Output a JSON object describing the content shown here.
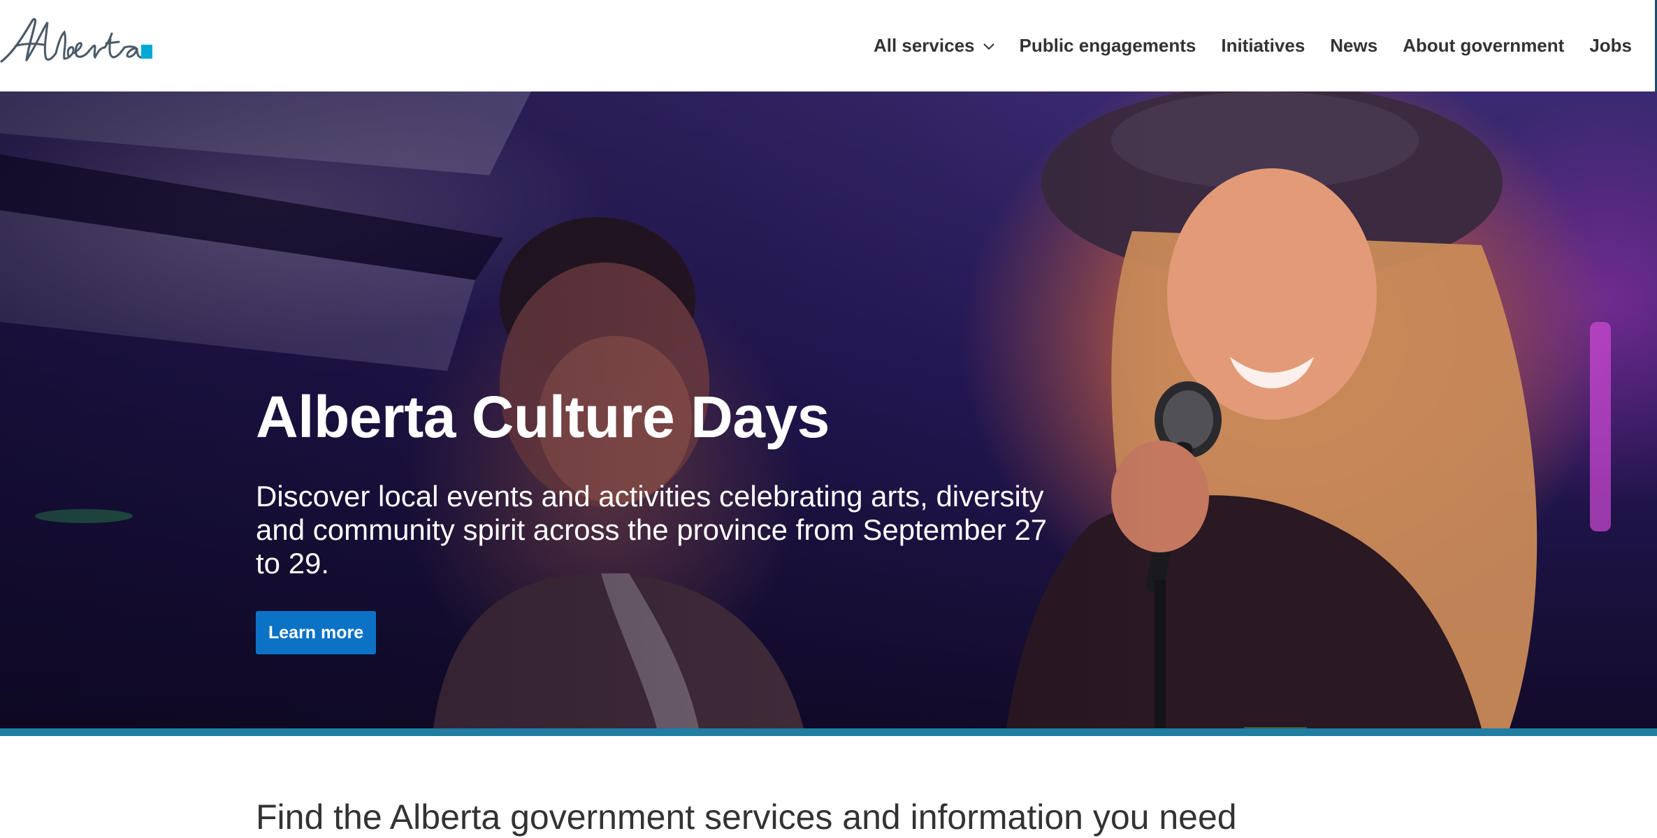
{
  "header": {
    "logo_text": "Alberta",
    "nav": [
      {
        "label": "All services",
        "has_dropdown": true,
        "icon": "chevron-down-icon"
      },
      {
        "label": "Public engagements"
      },
      {
        "label": "Initiatives"
      },
      {
        "label": "News"
      },
      {
        "label": "About government"
      },
      {
        "label": "Jobs"
      }
    ]
  },
  "hero": {
    "title": "Alberta Culture Days",
    "description": "Discover local events and activities celebrating arts, diversity and community spirit across the province from September 27 to 29.",
    "button_label": "Learn more"
  },
  "intro": {
    "heading": "Find the Alberta government services and information you need"
  },
  "colors": {
    "brand_blue": "#0b72c6",
    "accent_teal": "#1f7ea1",
    "logo_square": "#00aad2",
    "text_dark": "#333333"
  }
}
